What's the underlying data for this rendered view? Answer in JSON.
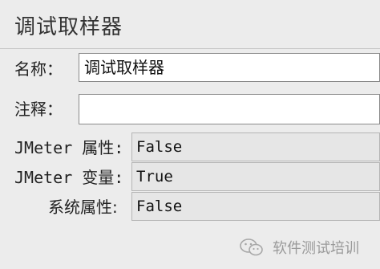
{
  "header": {
    "title": "调试取样器"
  },
  "form": {
    "name_label": "名称：",
    "name_value": "调试取样器",
    "comment_label": "注释：",
    "comment_value": ""
  },
  "settings": [
    {
      "label": "JMeter 属性:",
      "value": "False"
    },
    {
      "label": "JMeter 变量:",
      "value": "True"
    },
    {
      "label": "系统属性:",
      "value": "False"
    }
  ],
  "watermark": {
    "text": "软件测试培训",
    "icon": "wechat-icon"
  },
  "colors": {
    "background": "#ececec",
    "field_bg": "#ffffff",
    "readonly_bg": "#e6e6e6",
    "watermark": "#9a9a9a"
  }
}
